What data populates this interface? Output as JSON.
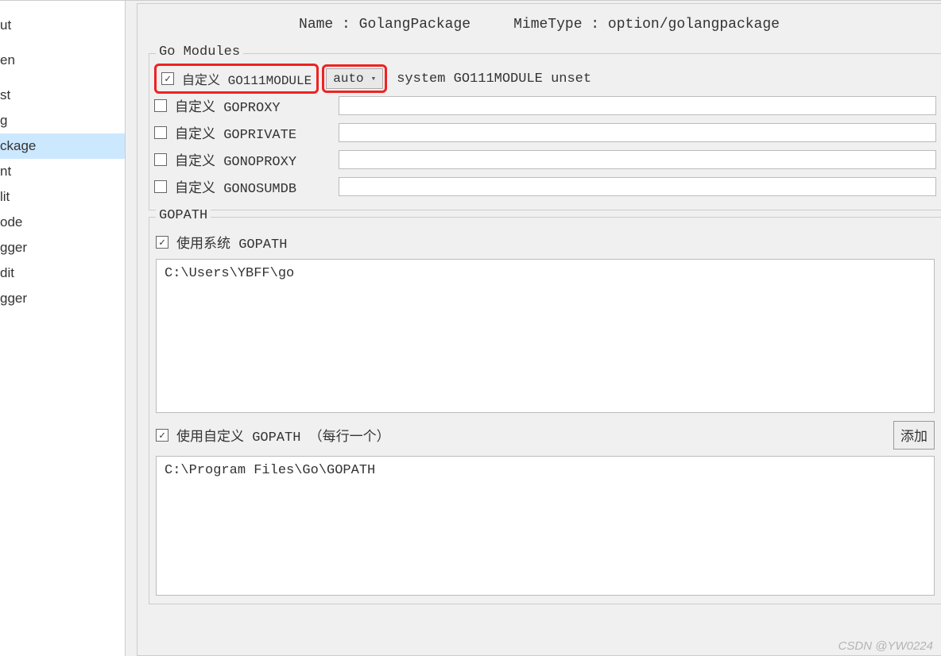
{
  "sidebar": {
    "items": [
      {
        "label": "ut"
      },
      {
        "label": ""
      },
      {
        "label": "en"
      },
      {
        "label": ""
      },
      {
        "label": "st"
      },
      {
        "label": "g"
      },
      {
        "label": "ckage"
      },
      {
        "label": "nt"
      },
      {
        "label": "lit"
      },
      {
        "label": "ode"
      },
      {
        "label": "gger"
      },
      {
        "label": "dit"
      },
      {
        "label": "gger"
      }
    ],
    "selected_index": 6
  },
  "header": {
    "name_label": "Name : ",
    "name_value": "GolangPackage",
    "mime_label": "MimeType : ",
    "mime_value": "option/golangpackage"
  },
  "go_modules": {
    "legend": "Go Modules",
    "go111module": {
      "label": "自定义 GO111MODULE",
      "checked": true,
      "select_value": "auto",
      "hint": "system GO111MODULE unset"
    },
    "goproxy": {
      "label": "自定义 GOPROXY",
      "checked": false,
      "value": ""
    },
    "goprivate": {
      "label": "自定义 GOPRIVATE",
      "checked": false,
      "value": ""
    },
    "gonoproxy": {
      "label": "自定义 GONOPROXY",
      "checked": false,
      "value": ""
    },
    "gonosumdb": {
      "label": "自定义 GONOSUMDB",
      "checked": false,
      "value": ""
    }
  },
  "gopath": {
    "legend": "GOPATH",
    "use_system": {
      "label": "使用系统 GOPATH",
      "checked": true
    },
    "system_value": "C:\\Users\\YBFF\\go",
    "use_custom": {
      "label": "使用自定义 GOPATH （每行一个）",
      "checked": true
    },
    "add_button": "添加",
    "custom_value": "C:\\Program Files\\Go\\GOPATH"
  },
  "watermark": "CSDN @YW0224"
}
